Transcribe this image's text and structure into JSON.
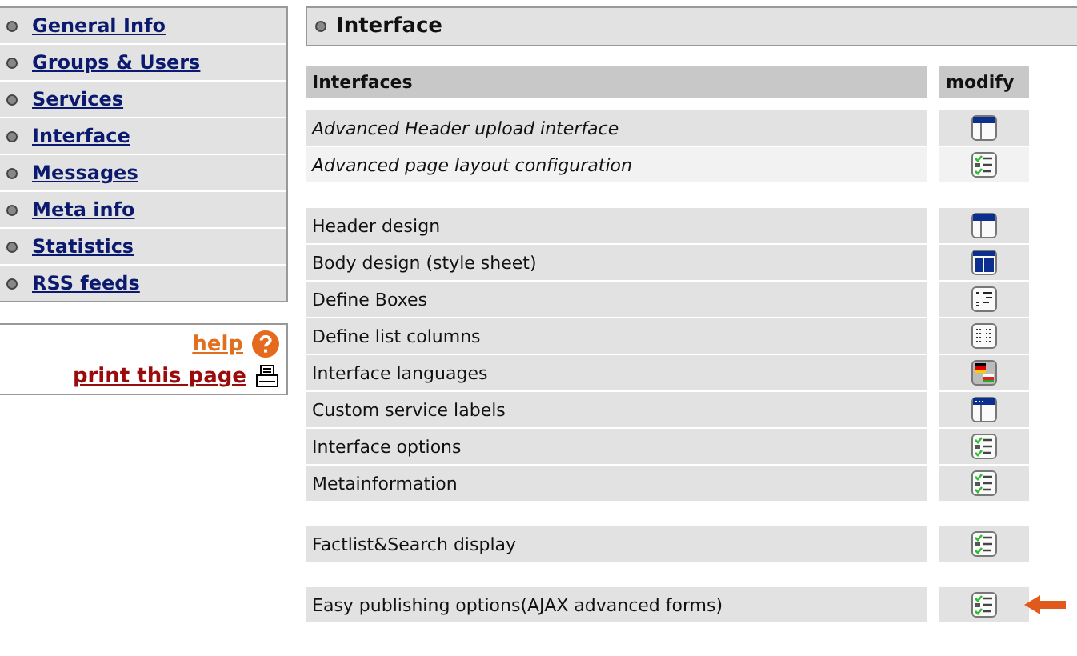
{
  "sidebar": {
    "items": [
      {
        "label": "General Info",
        "selected": false
      },
      {
        "label": "Groups & Users",
        "selected": false
      },
      {
        "label": "Services",
        "selected": false
      },
      {
        "label": "Interface",
        "selected": false
      },
      {
        "label": "Messages",
        "selected": false
      },
      {
        "label": "Meta info",
        "selected": false
      },
      {
        "label": "Statistics",
        "selected": false
      },
      {
        "label": "RSS feeds",
        "selected": false
      }
    ],
    "help": {
      "label": "help"
    },
    "print": {
      "label": "print this page"
    }
  },
  "main": {
    "title": "Interface",
    "table": {
      "columns": [
        "Interfaces",
        "modify"
      ],
      "groups": [
        {
          "kind": "advanced",
          "rows": [
            {
              "label": "Advanced Header upload interface",
              "kind": "header",
              "marked": false
            },
            {
              "label": "Advanced page layout configuration",
              "kind": "checklist",
              "marked": false
            }
          ]
        },
        {
          "kind": "plain",
          "rows": [
            {
              "label": "Header design",
              "kind": "header",
              "marked": false
            },
            {
              "label": "Body design (style sheet)",
              "kind": "body",
              "marked": false
            },
            {
              "label": "Define Boxes",
              "kind": "boxes",
              "marked": false
            },
            {
              "label": "Define list columns",
              "kind": "list",
              "marked": false
            },
            {
              "label": "Interface languages",
              "kind": "flags",
              "marked": false
            },
            {
              "label": "Custom service labels",
              "kind": "labels",
              "marked": false
            },
            {
              "label": "Interface options",
              "kind": "checklist",
              "marked": false
            },
            {
              "label": "Metainformation",
              "kind": "checklist",
              "marked": false
            }
          ]
        },
        {
          "kind": "plain",
          "rows": [
            {
              "label": "Factlist&Search display",
              "kind": "checklist",
              "marked": false
            }
          ]
        },
        {
          "kind": "plain",
          "rows": [
            {
              "label": "Easy publishing options(AJAX advanced forms)",
              "kind": "checklist",
              "marked": true
            }
          ]
        }
      ]
    }
  }
}
